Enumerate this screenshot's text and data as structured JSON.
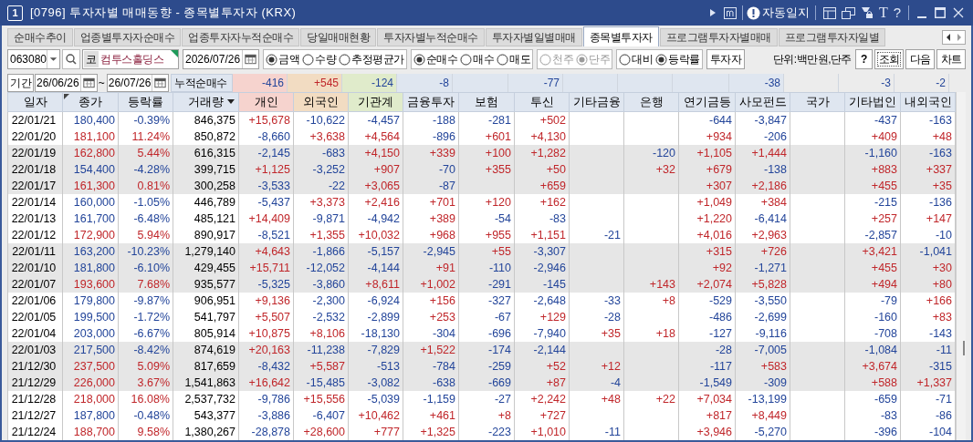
{
  "window": {
    "number": "1",
    "title": "[0796] 투자자별 매매동향 - 종목별투자자 (KRX)",
    "auto_log": "자동일지",
    "text_tool": "T",
    "help": "?"
  },
  "tabs": [
    {
      "label": "순매수추이",
      "selected": false
    },
    {
      "label": "업종별투자자순매수",
      "selected": false
    },
    {
      "label": "업종투자자누적순매수",
      "selected": false
    },
    {
      "label": "당일매매현황",
      "selected": false
    },
    {
      "label": "투자자별누적순매수",
      "selected": false
    },
    {
      "label": "투자자별일별매매",
      "selected": false
    },
    {
      "label": "종목별투자자",
      "selected": true
    },
    {
      "label": "프로그램투자자별매매",
      "selected": false
    },
    {
      "label": "프로그램투자자일별",
      "selected": false
    }
  ],
  "toolbar": {
    "code": "063080",
    "market_badge": "코",
    "stock_name": "컴투스홀딩스",
    "date": "2026/07/26",
    "radio_groups": [
      {
        "disabled": false,
        "options": [
          {
            "label": "금액",
            "selected": true
          },
          {
            "label": "수량",
            "selected": false
          },
          {
            "label": "추정평균가",
            "selected": false
          }
        ]
      },
      {
        "disabled": false,
        "options": [
          {
            "label": "순매수",
            "selected": true
          },
          {
            "label": "매수",
            "selected": false
          },
          {
            "label": "매도",
            "selected": false
          }
        ]
      },
      {
        "disabled": true,
        "options": [
          {
            "label": "천주",
            "selected": false
          },
          {
            "label": "단주",
            "selected": true
          }
        ]
      },
      {
        "disabled": false,
        "options": [
          {
            "label": "대비",
            "selected": false
          },
          {
            "label": "등락률",
            "selected": true
          }
        ]
      }
    ],
    "investor_button": "투자자",
    "unit": "단위:백만원,단주",
    "buttons": [
      "?",
      "조회",
      "다음",
      "차트"
    ]
  },
  "period": {
    "label": "기간",
    "from": "26/06/26",
    "separator": "~",
    "to": "26/07/26",
    "summary_label": "누적순매수",
    "summary": {
      "individual": "-416",
      "foreign": "+545",
      "institution": "-124",
      "financial_investment": "-8",
      "investment_trust": "-77",
      "private_fund": "-38",
      "other_corporation": "-3",
      "domestic_foreigner": "-2"
    }
  },
  "table": {
    "columns": [
      "일자",
      "종가",
      "등락률",
      "거래량",
      "개인",
      "외국인",
      "기관계",
      "금융투자",
      "보험",
      "투신",
      "기타금융",
      "은행",
      "연기금등",
      "사모펀드",
      "국가",
      "기타법인",
      "내외국인"
    ],
    "rows": [
      {
        "shaded": false,
        "cells": [
          "22/01/21",
          "180,400",
          "-0.39%",
          "846,375",
          "+15,678",
          "-10,622",
          "-4,457",
          "-188",
          "-281",
          "+502",
          null,
          null,
          "-644",
          "-3,847",
          null,
          "-437",
          "-163"
        ]
      },
      {
        "shaded": false,
        "cells": [
          "22/01/20",
          "181,100",
          "11.24%",
          "850,872",
          "-8,660",
          "+3,638",
          "+4,564",
          "-896",
          "+601",
          "+4,130",
          null,
          null,
          "+934",
          "-206",
          null,
          "+409",
          "+48"
        ]
      },
      {
        "shaded": true,
        "cells": [
          "22/01/19",
          "162,800",
          "5.44%",
          "616,315",
          "-2,145",
          "-683",
          "+4,150",
          "+339",
          "+100",
          "+1,282",
          null,
          "-120",
          "+1,105",
          "+1,444",
          null,
          "-1,160",
          "-163"
        ]
      },
      {
        "shaded": true,
        "cells": [
          "22/01/18",
          "154,400",
          "-4.28%",
          "399,715",
          "+1,125",
          "-3,252",
          "+907",
          "-70",
          "+355",
          "+50",
          null,
          "+32",
          "+679",
          "-138",
          null,
          "+883",
          "+337"
        ]
      },
      {
        "shaded": true,
        "cells": [
          "22/01/17",
          "161,300",
          "0.81%",
          "300,258",
          "-3,533",
          "-22",
          "+3,065",
          "-87",
          null,
          "+659",
          null,
          null,
          "+307",
          "+2,186",
          null,
          "+455",
          "+35"
        ]
      },
      {
        "shaded": false,
        "cells": [
          "22/01/14",
          "160,000",
          "-1.05%",
          "446,789",
          "-5,437",
          "+3,373",
          "+2,416",
          "+701",
          "+120",
          "+162",
          null,
          null,
          "+1,049",
          "+384",
          null,
          "-215",
          "-136"
        ]
      },
      {
        "shaded": false,
        "cells": [
          "22/01/13",
          "161,700",
          "-6.48%",
          "485,121",
          "+14,409",
          "-9,871",
          "-4,942",
          "+389",
          "-54",
          "-83",
          null,
          null,
          "+1,220",
          "-6,414",
          null,
          "+257",
          "+147"
        ]
      },
      {
        "shaded": false,
        "cells": [
          "22/01/12",
          "172,900",
          "5.94%",
          "890,917",
          "-8,521",
          "+1,355",
          "+10,032",
          "+968",
          "+955",
          "+1,151",
          "-21",
          null,
          "+4,016",
          "+2,963",
          null,
          "-2,857",
          "-10"
        ]
      },
      {
        "shaded": true,
        "cells": [
          "22/01/11",
          "163,200",
          "-10.23%",
          "1,279,140",
          "+4,643",
          "-1,866",
          "-5,157",
          "-2,945",
          "+55",
          "-3,307",
          null,
          null,
          "+315",
          "+726",
          null,
          "+3,421",
          "-1,041"
        ]
      },
      {
        "shaded": true,
        "cells": [
          "22/01/10",
          "181,800",
          "-6.10%",
          "429,455",
          "+15,711",
          "-12,052",
          "-4,144",
          "+91",
          "-110",
          "-2,946",
          null,
          null,
          "+92",
          "-1,271",
          null,
          "+455",
          "+30"
        ]
      },
      {
        "shaded": true,
        "cells": [
          "22/01/07",
          "193,600",
          "7.68%",
          "935,577",
          "-5,325",
          "-3,860",
          "+8,611",
          "+1,002",
          "-291",
          "-145",
          null,
          "+143",
          "+2,074",
          "+5,828",
          null,
          "+494",
          "+80"
        ]
      },
      {
        "shaded": false,
        "cells": [
          "22/01/06",
          "179,800",
          "-9.87%",
          "906,951",
          "+9,136",
          "-2,300",
          "-6,924",
          "+156",
          "-327",
          "-2,648",
          "-33",
          "+8",
          "-529",
          "-3,550",
          null,
          "-79",
          "+166"
        ]
      },
      {
        "shaded": false,
        "cells": [
          "22/01/05",
          "199,500",
          "-1.72%",
          "541,797",
          "+5,507",
          "-2,532",
          "-2,899",
          "+253",
          "-67",
          "+129",
          "-28",
          null,
          "-486",
          "-2,699",
          null,
          "-160",
          "+83"
        ]
      },
      {
        "shaded": false,
        "cells": [
          "22/01/04",
          "203,000",
          "-6.67%",
          "805,914",
          "+10,875",
          "+8,106",
          "-18,130",
          "-304",
          "-696",
          "-7,940",
          "+35",
          "+18",
          "-127",
          "-9,116",
          null,
          "-708",
          "-143"
        ]
      },
      {
        "shaded": true,
        "cells": [
          "22/01/03",
          "217,500",
          "-8.42%",
          "874,619",
          "+20,163",
          "-11,238",
          "-7,829",
          "+1,522",
          "-174",
          "-2,144",
          null,
          null,
          "-28",
          "-7,005",
          null,
          "-1,084",
          "-11"
        ]
      },
      {
        "shaded": true,
        "cells": [
          "21/12/30",
          "237,500",
          "5.09%",
          "817,659",
          "-8,432",
          "+5,587",
          "-513",
          "-784",
          "-259",
          "+52",
          "+12",
          null,
          "-117",
          "+583",
          null,
          "+3,674",
          "-315"
        ]
      },
      {
        "shaded": true,
        "cells": [
          "21/12/29",
          "226,000",
          "3.67%",
          "1,541,863",
          "+16,642",
          "-15,485",
          "-3,082",
          "-638",
          "-669",
          "+87",
          "-4",
          null,
          "-1,549",
          "-309",
          null,
          "+588",
          "+1,337"
        ]
      },
      {
        "shaded": false,
        "cells": [
          "21/12/28",
          "218,000",
          "16.08%",
          "2,537,732",
          "-9,786",
          "+15,556",
          "-5,039",
          "-1,159",
          "-27",
          "+2,242",
          "+48",
          "+22",
          "+7,034",
          "-13,199",
          null,
          "-659",
          "-71"
        ]
      },
      {
        "shaded": false,
        "cells": [
          "21/12/27",
          "187,800",
          "-0.48%",
          "543,377",
          "-3,886",
          "-6,407",
          "+10,462",
          "+461",
          "+8",
          "+727",
          null,
          null,
          "+817",
          "+8,449",
          null,
          "-83",
          "-86"
        ]
      },
      {
        "shaded": false,
        "cells": [
          "21/12/24",
          "188,700",
          "9.58%",
          "1,380,267",
          "-28,878",
          "+28,600",
          "+777",
          "+1,325",
          "-223",
          "+1,010",
          "-11",
          null,
          "+3,946",
          "-5,270",
          null,
          "-396",
          "-104"
        ]
      }
    ]
  }
}
